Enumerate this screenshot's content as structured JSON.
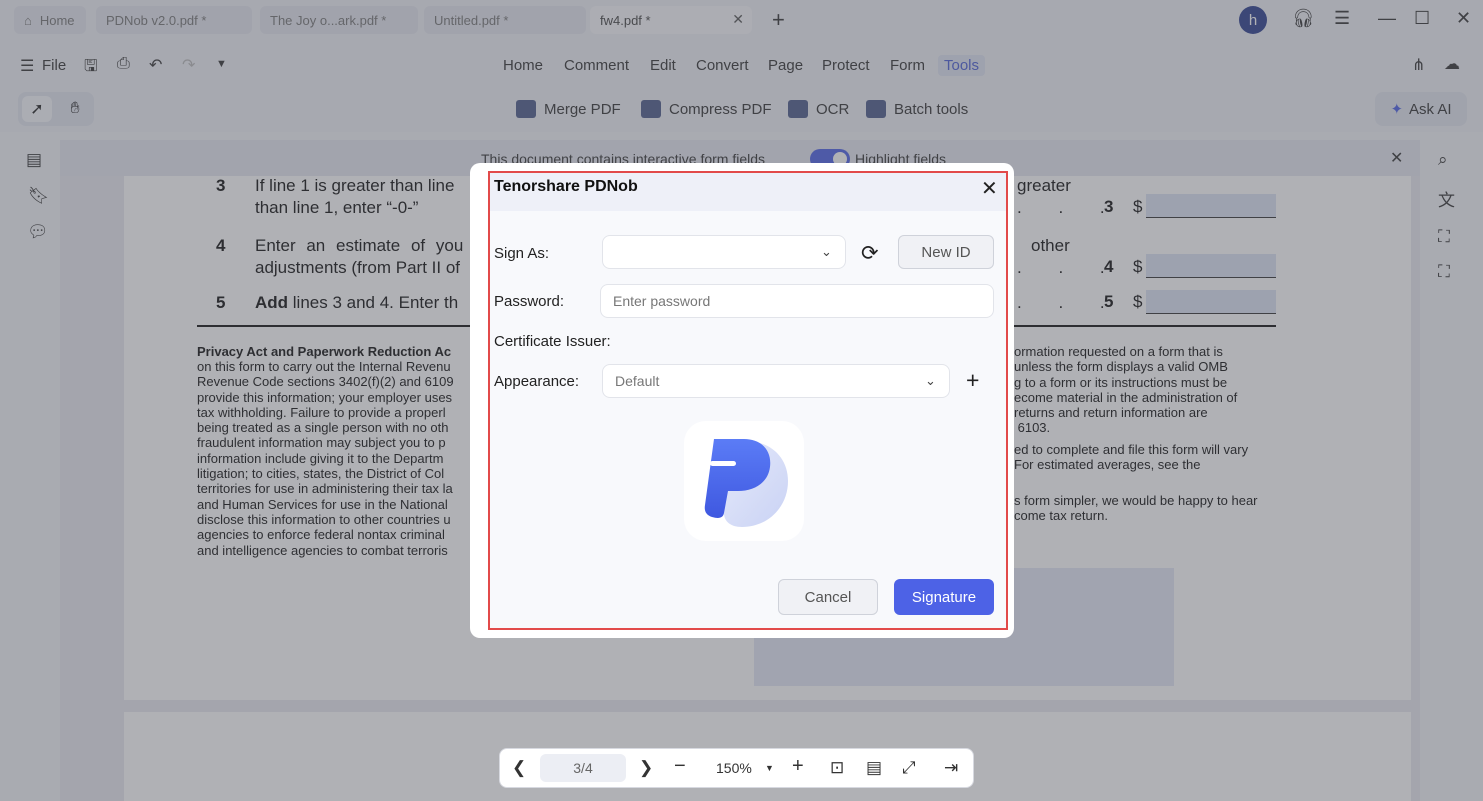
{
  "tabs": [
    {
      "label": "Home",
      "icon": "home-icon"
    },
    {
      "label": "PDNob v2.0.pdf *"
    },
    {
      "label": "The Joy o...ark.pdf *"
    },
    {
      "label": "Untitled.pdf *"
    },
    {
      "label": "fw4.pdf *",
      "active": true,
      "close": "✕"
    }
  ],
  "tab_add": "+",
  "user_initial": "h",
  "menu": {
    "file": "File",
    "items": [
      "Home",
      "Comment",
      "Edit",
      "Convert",
      "Page",
      "Protect",
      "Form",
      "Tools"
    ],
    "active": "Tools"
  },
  "tools": {
    "items": [
      "Merge PDF",
      "Compress PDF",
      "OCR",
      "Batch tools"
    ],
    "ask_ai": "Ask AI"
  },
  "banner": {
    "text": "This document contains interactive form fields",
    "toggle_label": "Highlight fields",
    "toggle_on": true
  },
  "document": {
    "line3_num": "3",
    "line3_a": "If line 1 is greater than line",
    "line3_b": "than line 1, enter “-0-”",
    "line3_r": "greater",
    "line4_num": "4",
    "line4_a": "Enter an estimate of you",
    "line4_b": "adjustments (from Part II of",
    "line4_r": "other",
    "line5_num": "5",
    "line5_bold": "Add",
    "line5_a": " lines 3 and 4. Enter th",
    "dots": ". . .",
    "right_num3": "3",
    "right_num4": "4",
    "right_num5": "5",
    "dollar": "$",
    "left_para_title": "Privacy Act and Paperwork Reduction Ac",
    "left_para": "on this form to carry out the Internal Revenu\nRevenue Code sections 3402(f)(2) and 6109\nprovide this information; your employer uses\ntax withholding. Failure to provide a properl\nbeing treated as a single person with no oth\nfraudulent information may subject you to p\ninformation include giving it to the Departm\nlitigation; to cities, states, the District of Col\nterritories for use in administering their tax la\nand Human Services for use in the National\ndisclose this information to other countries u\nagencies to enforce federal nontax criminal\nand intelligence agencies to combat terroris",
    "right_para_1": "ormation requested on a form that is\nunless the form displays a valid OMB\ng to a form or its instructions must be\necome material in the administration of\nreturns and return information are\n 6103.",
    "right_para_2": "ed to complete and file this form will vary\nFor estimated averages, see the",
    "right_para_3": "s form simpler, we would be happy to hear\ncome tax return."
  },
  "dialog": {
    "title": "Tenorshare PDNob",
    "sign_as_label": "Sign As:",
    "sign_as_value": "",
    "new_id": "New ID",
    "password_label": "Password:",
    "password_placeholder": "Enter password",
    "issuer_label": "Certificate Issuer:",
    "issuer_value": "",
    "appearance_label": "Appearance:",
    "appearance_value": "Default",
    "cancel": "Cancel",
    "signature": "Signature",
    "accent": "#4d62e6",
    "highlight_border": "#e24a4a"
  },
  "bottom": {
    "page": "3/4",
    "zoom": "150%"
  }
}
